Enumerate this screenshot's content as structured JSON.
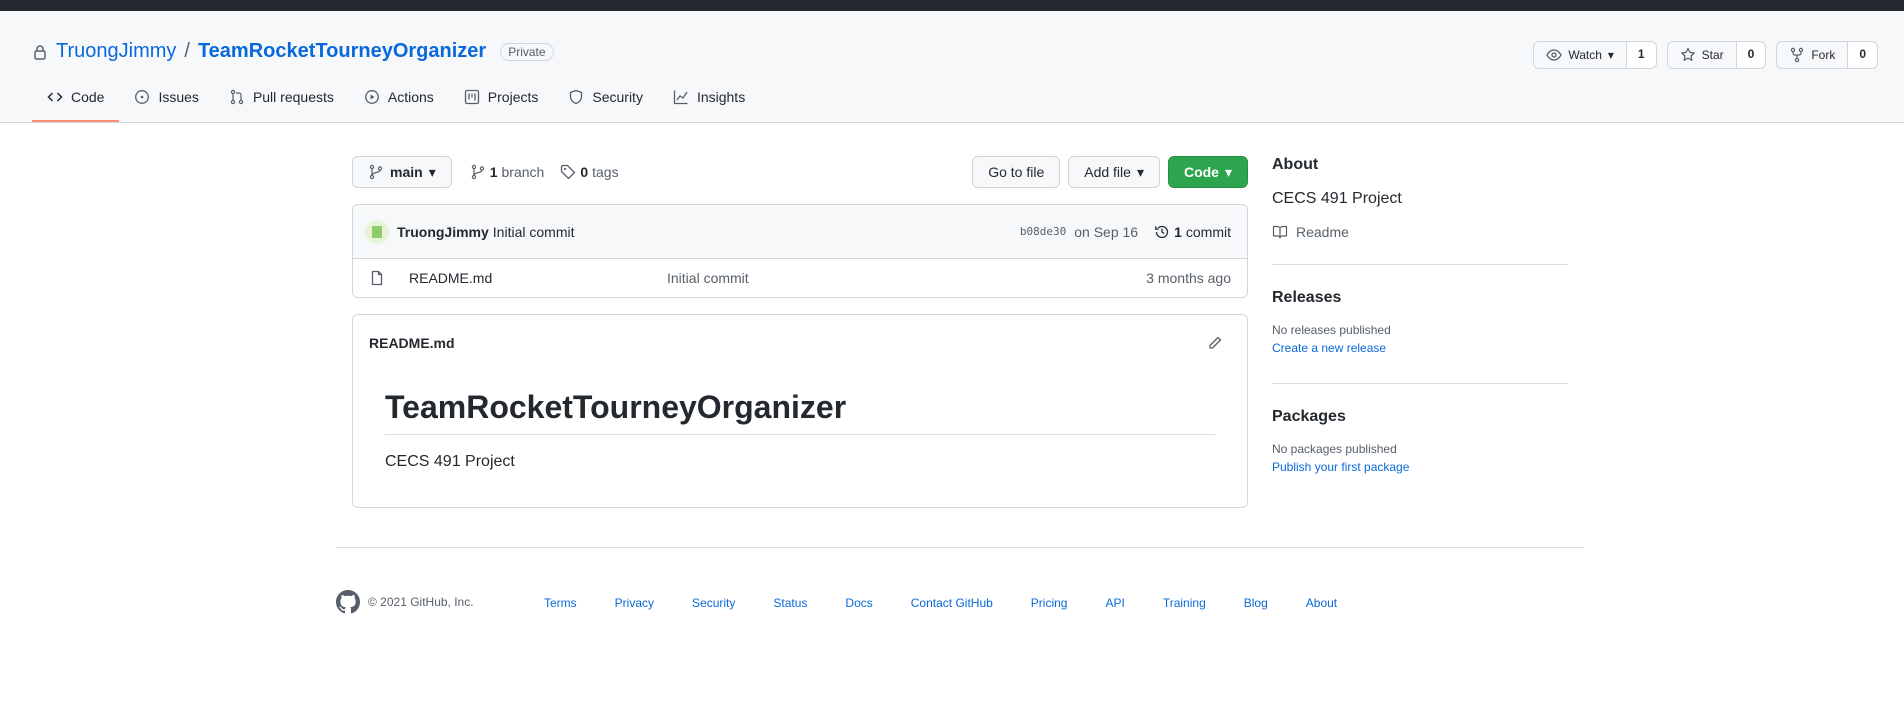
{
  "repo": {
    "owner": "TruongJimmy",
    "separator": "/",
    "name": "TeamRocketTourneyOrganizer",
    "visibility": "Private"
  },
  "header_actions": {
    "watch_label": "Watch",
    "watch_count": "1",
    "star_label": "Star",
    "star_count": "0",
    "fork_label": "Fork",
    "fork_count": "0"
  },
  "tabs": [
    {
      "label": "Code",
      "icon": "code-icon",
      "active": true
    },
    {
      "label": "Issues",
      "icon": "issue-icon"
    },
    {
      "label": "Pull requests",
      "icon": "pull-request-icon"
    },
    {
      "label": "Actions",
      "icon": "play-icon"
    },
    {
      "label": "Projects",
      "icon": "project-icon"
    },
    {
      "label": "Security",
      "icon": "shield-icon"
    },
    {
      "label": "Insights",
      "icon": "graph-icon"
    }
  ],
  "filebar": {
    "branch": "main",
    "branch_count": "1",
    "branch_label": "branch",
    "tag_count": "0",
    "tag_label": "tags",
    "go_to_file": "Go to file",
    "add_file": "Add file",
    "code": "Code"
  },
  "latest_commit": {
    "author": "TruongJimmy",
    "message": "Initial commit",
    "sha": "b08de30",
    "date": "on Sep 16",
    "commit_count": "1",
    "commit_label": "commit"
  },
  "files": [
    {
      "name": "README.md",
      "message": "Initial commit",
      "age": "3 months ago"
    }
  ],
  "readme": {
    "filename": "README.md",
    "heading": "TeamRocketTourneyOrganizer",
    "body": "CECS 491 Project"
  },
  "about": {
    "title": "About",
    "description": "CECS 491 Project",
    "readme_link": "Readme"
  },
  "releases": {
    "title": "Releases",
    "empty": "No releases published",
    "link": "Create a new release"
  },
  "packages": {
    "title": "Packages",
    "empty": "No packages published",
    "link": "Publish your first package"
  },
  "footer": {
    "copyright": "© 2021 GitHub, Inc.",
    "links": [
      "Terms",
      "Privacy",
      "Security",
      "Status",
      "Docs",
      "Contact GitHub",
      "Pricing",
      "API",
      "Training",
      "Blog",
      "About"
    ]
  },
  "colors": {
    "link": "#0969da",
    "primary_button": "#2da44e",
    "active_tab_underline": "#fd8c73",
    "top_bar": "#24292f"
  }
}
